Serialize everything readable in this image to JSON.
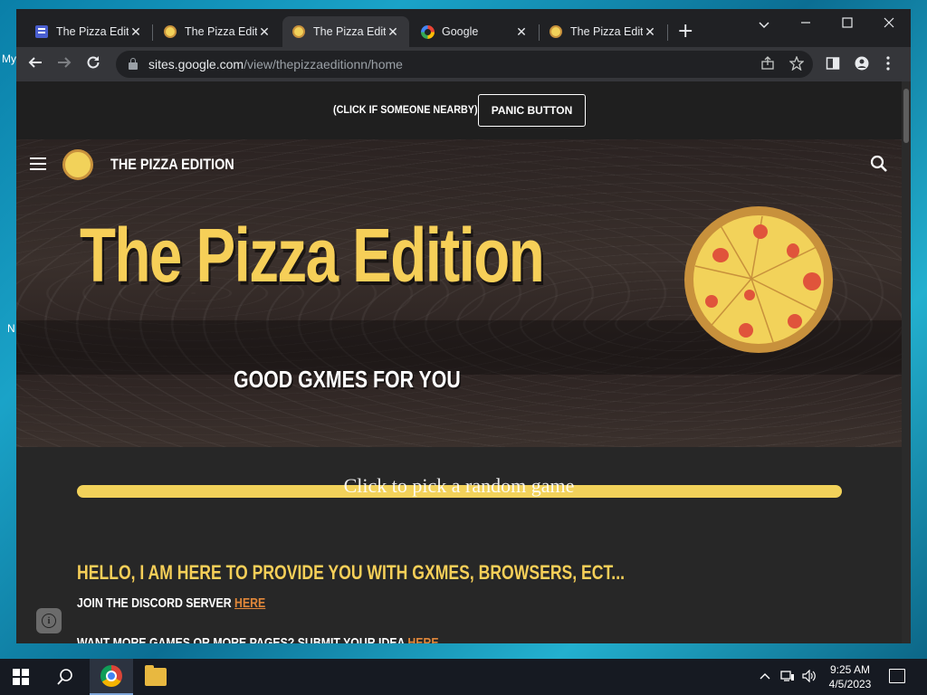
{
  "desktop": {
    "label_top": "My",
    "label_mid": "N"
  },
  "tabs": [
    {
      "title": "The Pizza Editi",
      "icon": "google-sites-icon",
      "active": false
    },
    {
      "title": "The Pizza Editi",
      "icon": "pizza-icon",
      "active": false
    },
    {
      "title": "The Pizza Editi",
      "icon": "pizza-icon",
      "active": true
    },
    {
      "title": "Google",
      "icon": "google-icon",
      "active": false
    },
    {
      "title": "The Pizza Editi",
      "icon": "pizza-icon",
      "active": false
    }
  ],
  "tab_close_glyph": "✕",
  "new_tab_glyph": "+",
  "address": {
    "host": "sites.google.com",
    "path": "/view/thepizzaeditionn/home"
  },
  "page": {
    "panic_caption": "(CLICK IF SOMEONE NEARBY)",
    "panic_button": "PANIC BUTTON",
    "site_name": "THE PIZZA EDITION",
    "hero_title": "The Pizza Edition",
    "hero_subtitle": "GOOD GXMES FOR YOU",
    "random_game": "Click to pick a random game",
    "hello": "HELLO, I AM HERE TO PROVIDE YOU WITH GXMES, BROWSERS, ECT...",
    "discord_text": "JOIN THE DISCORD SERVER ",
    "discord_link": "HERE",
    "submit_text": "WANT MORE GAMES OR MORE PAGES? SUBMIT YOUR IDEA ",
    "submit_link": "HERE"
  },
  "taskbar": {
    "time": "9:25 AM",
    "date": "4/5/2023"
  },
  "colors": {
    "accent_yellow": "#f6cf58",
    "link_orange": "#e0873a",
    "page_bg": "#272727"
  }
}
